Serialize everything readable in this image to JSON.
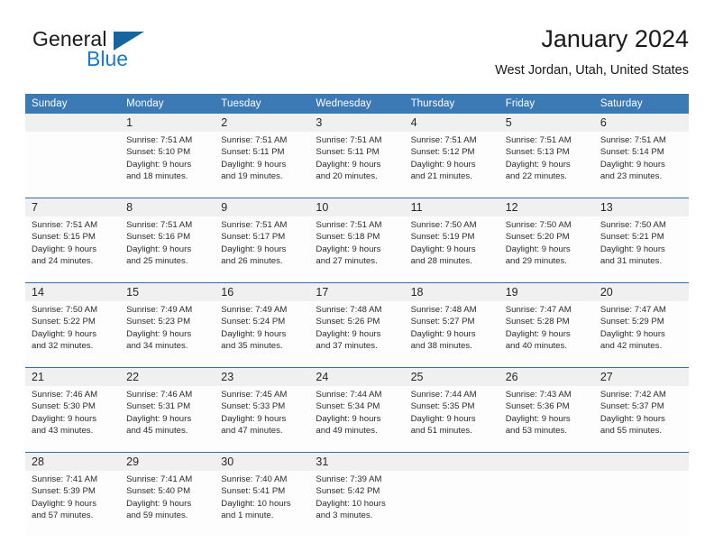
{
  "brand": {
    "name_part1": "General",
    "name_part2": "Blue",
    "triangle_color": "#17659e",
    "blue_text_color": "#1a7ac8"
  },
  "header": {
    "title": "January 2024",
    "subtitle": "West Jordan, Utah, United States"
  },
  "theme": {
    "header_blue": "#3c7ab6",
    "separator_blue": "#2f6fae",
    "daynum_band": "#f0f0f0",
    "cell_background": "#fdfdfd",
    "text": "#2b2b2b"
  },
  "weekday_headers": [
    "Sunday",
    "Monday",
    "Tuesday",
    "Wednesday",
    "Thursday",
    "Friday",
    "Saturday"
  ],
  "weeks": [
    {
      "days": [
        {
          "day": "",
          "sunrise": "",
          "sunset": "",
          "daylight_line1": "",
          "daylight_line2": "",
          "empty": true
        },
        {
          "day": "1",
          "sunrise": "Sunrise: 7:51 AM",
          "sunset": "Sunset: 5:10 PM",
          "daylight_line1": "Daylight: 9 hours",
          "daylight_line2": "and 18 minutes.",
          "empty": false
        },
        {
          "day": "2",
          "sunrise": "Sunrise: 7:51 AM",
          "sunset": "Sunset: 5:11 PM",
          "daylight_line1": "Daylight: 9 hours",
          "daylight_line2": "and 19 minutes.",
          "empty": false
        },
        {
          "day": "3",
          "sunrise": "Sunrise: 7:51 AM",
          "sunset": "Sunset: 5:11 PM",
          "daylight_line1": "Daylight: 9 hours",
          "daylight_line2": "and 20 minutes.",
          "empty": false
        },
        {
          "day": "4",
          "sunrise": "Sunrise: 7:51 AM",
          "sunset": "Sunset: 5:12 PM",
          "daylight_line1": "Daylight: 9 hours",
          "daylight_line2": "and 21 minutes.",
          "empty": false
        },
        {
          "day": "5",
          "sunrise": "Sunrise: 7:51 AM",
          "sunset": "Sunset: 5:13 PM",
          "daylight_line1": "Daylight: 9 hours",
          "daylight_line2": "and 22 minutes.",
          "empty": false
        },
        {
          "day": "6",
          "sunrise": "Sunrise: 7:51 AM",
          "sunset": "Sunset: 5:14 PM",
          "daylight_line1": "Daylight: 9 hours",
          "daylight_line2": "and 23 minutes.",
          "empty": false
        }
      ]
    },
    {
      "days": [
        {
          "day": "7",
          "sunrise": "Sunrise: 7:51 AM",
          "sunset": "Sunset: 5:15 PM",
          "daylight_line1": "Daylight: 9 hours",
          "daylight_line2": "and 24 minutes.",
          "empty": false
        },
        {
          "day": "8",
          "sunrise": "Sunrise: 7:51 AM",
          "sunset": "Sunset: 5:16 PM",
          "daylight_line1": "Daylight: 9 hours",
          "daylight_line2": "and 25 minutes.",
          "empty": false
        },
        {
          "day": "9",
          "sunrise": "Sunrise: 7:51 AM",
          "sunset": "Sunset: 5:17 PM",
          "daylight_line1": "Daylight: 9 hours",
          "daylight_line2": "and 26 minutes.",
          "empty": false
        },
        {
          "day": "10",
          "sunrise": "Sunrise: 7:51 AM",
          "sunset": "Sunset: 5:18 PM",
          "daylight_line1": "Daylight: 9 hours",
          "daylight_line2": "and 27 minutes.",
          "empty": false
        },
        {
          "day": "11",
          "sunrise": "Sunrise: 7:50 AM",
          "sunset": "Sunset: 5:19 PM",
          "daylight_line1": "Daylight: 9 hours",
          "daylight_line2": "and 28 minutes.",
          "empty": false
        },
        {
          "day": "12",
          "sunrise": "Sunrise: 7:50 AM",
          "sunset": "Sunset: 5:20 PM",
          "daylight_line1": "Daylight: 9 hours",
          "daylight_line2": "and 29 minutes.",
          "empty": false
        },
        {
          "day": "13",
          "sunrise": "Sunrise: 7:50 AM",
          "sunset": "Sunset: 5:21 PM",
          "daylight_line1": "Daylight: 9 hours",
          "daylight_line2": "and 31 minutes.",
          "empty": false
        }
      ]
    },
    {
      "days": [
        {
          "day": "14",
          "sunrise": "Sunrise: 7:50 AM",
          "sunset": "Sunset: 5:22 PM",
          "daylight_line1": "Daylight: 9 hours",
          "daylight_line2": "and 32 minutes.",
          "empty": false
        },
        {
          "day": "15",
          "sunrise": "Sunrise: 7:49 AM",
          "sunset": "Sunset: 5:23 PM",
          "daylight_line1": "Daylight: 9 hours",
          "daylight_line2": "and 34 minutes.",
          "empty": false
        },
        {
          "day": "16",
          "sunrise": "Sunrise: 7:49 AM",
          "sunset": "Sunset: 5:24 PM",
          "daylight_line1": "Daylight: 9 hours",
          "daylight_line2": "and 35 minutes.",
          "empty": false
        },
        {
          "day": "17",
          "sunrise": "Sunrise: 7:48 AM",
          "sunset": "Sunset: 5:26 PM",
          "daylight_line1": "Daylight: 9 hours",
          "daylight_line2": "and 37 minutes.",
          "empty": false
        },
        {
          "day": "18",
          "sunrise": "Sunrise: 7:48 AM",
          "sunset": "Sunset: 5:27 PM",
          "daylight_line1": "Daylight: 9 hours",
          "daylight_line2": "and 38 minutes.",
          "empty": false
        },
        {
          "day": "19",
          "sunrise": "Sunrise: 7:47 AM",
          "sunset": "Sunset: 5:28 PM",
          "daylight_line1": "Daylight: 9 hours",
          "daylight_line2": "and 40 minutes.",
          "empty": false
        },
        {
          "day": "20",
          "sunrise": "Sunrise: 7:47 AM",
          "sunset": "Sunset: 5:29 PM",
          "daylight_line1": "Daylight: 9 hours",
          "daylight_line2": "and 42 minutes.",
          "empty": false
        }
      ]
    },
    {
      "days": [
        {
          "day": "21",
          "sunrise": "Sunrise: 7:46 AM",
          "sunset": "Sunset: 5:30 PM",
          "daylight_line1": "Daylight: 9 hours",
          "daylight_line2": "and 43 minutes.",
          "empty": false
        },
        {
          "day": "22",
          "sunrise": "Sunrise: 7:46 AM",
          "sunset": "Sunset: 5:31 PM",
          "daylight_line1": "Daylight: 9 hours",
          "daylight_line2": "and 45 minutes.",
          "empty": false
        },
        {
          "day": "23",
          "sunrise": "Sunrise: 7:45 AM",
          "sunset": "Sunset: 5:33 PM",
          "daylight_line1": "Daylight: 9 hours",
          "daylight_line2": "and 47 minutes.",
          "empty": false
        },
        {
          "day": "24",
          "sunrise": "Sunrise: 7:44 AM",
          "sunset": "Sunset: 5:34 PM",
          "daylight_line1": "Daylight: 9 hours",
          "daylight_line2": "and 49 minutes.",
          "empty": false
        },
        {
          "day": "25",
          "sunrise": "Sunrise: 7:44 AM",
          "sunset": "Sunset: 5:35 PM",
          "daylight_line1": "Daylight: 9 hours",
          "daylight_line2": "and 51 minutes.",
          "empty": false
        },
        {
          "day": "26",
          "sunrise": "Sunrise: 7:43 AM",
          "sunset": "Sunset: 5:36 PM",
          "daylight_line1": "Daylight: 9 hours",
          "daylight_line2": "and 53 minutes.",
          "empty": false
        },
        {
          "day": "27",
          "sunrise": "Sunrise: 7:42 AM",
          "sunset": "Sunset: 5:37 PM",
          "daylight_line1": "Daylight: 9 hours",
          "daylight_line2": "and 55 minutes.",
          "empty": false
        }
      ]
    },
    {
      "days": [
        {
          "day": "28",
          "sunrise": "Sunrise: 7:41 AM",
          "sunset": "Sunset: 5:39 PM",
          "daylight_line1": "Daylight: 9 hours",
          "daylight_line2": "and 57 minutes.",
          "empty": false
        },
        {
          "day": "29",
          "sunrise": "Sunrise: 7:41 AM",
          "sunset": "Sunset: 5:40 PM",
          "daylight_line1": "Daylight: 9 hours",
          "daylight_line2": "and 59 minutes.",
          "empty": false
        },
        {
          "day": "30",
          "sunrise": "Sunrise: 7:40 AM",
          "sunset": "Sunset: 5:41 PM",
          "daylight_line1": "Daylight: 10 hours",
          "daylight_line2": "and 1 minute.",
          "empty": false
        },
        {
          "day": "31",
          "sunrise": "Sunrise: 7:39 AM",
          "sunset": "Sunset: 5:42 PM",
          "daylight_line1": "Daylight: 10 hours",
          "daylight_line2": "and 3 minutes.",
          "empty": false
        },
        {
          "day": "",
          "sunrise": "",
          "sunset": "",
          "daylight_line1": "",
          "daylight_line2": "",
          "empty": true
        },
        {
          "day": "",
          "sunrise": "",
          "sunset": "",
          "daylight_line1": "",
          "daylight_line2": "",
          "empty": true
        },
        {
          "day": "",
          "sunrise": "",
          "sunset": "",
          "daylight_line1": "",
          "daylight_line2": "",
          "empty": true
        }
      ]
    }
  ]
}
